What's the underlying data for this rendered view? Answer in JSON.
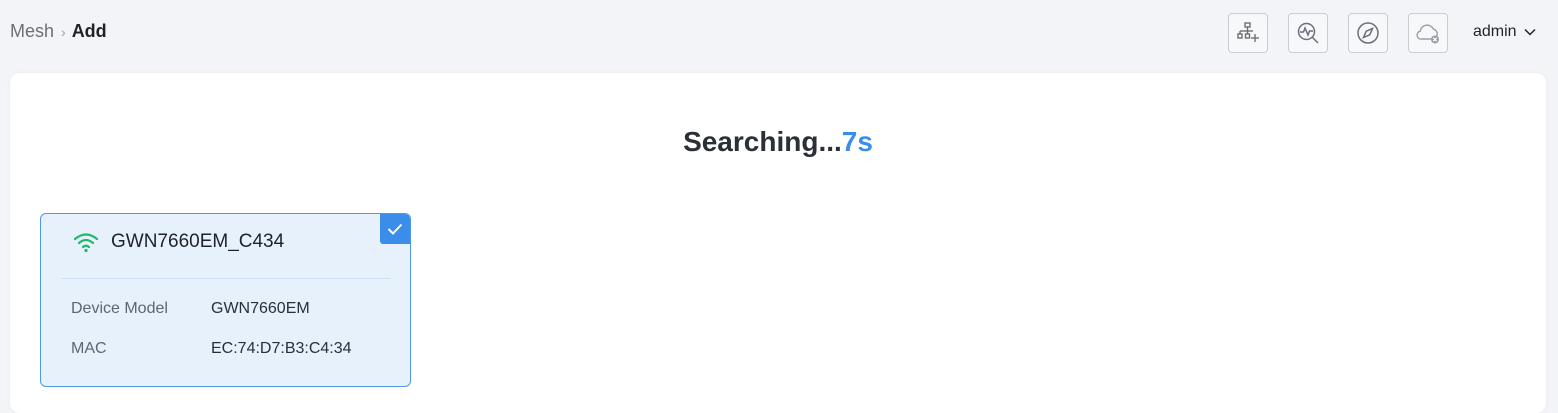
{
  "breadcrumb": {
    "parent": "Mesh",
    "separator": "›",
    "current": "Add"
  },
  "toolbar": {
    "buttons": [
      {
        "icon": "network-add-icon"
      },
      {
        "icon": "search-diagnostics-icon"
      },
      {
        "icon": "compass-icon"
      },
      {
        "icon": "cloud-disconnected-icon"
      }
    ]
  },
  "user": {
    "name": "admin"
  },
  "search": {
    "label": "Searching...",
    "seconds": "7s"
  },
  "device": {
    "name": "GWN7660EM_C434",
    "selected": true,
    "model_label": "Device Model",
    "model_value": "GWN7660EM",
    "mac_label": "MAC",
    "mac_value": "EC:74:D7:B3:C4:34"
  },
  "colors": {
    "accent": "#3a8de8",
    "wifi": "#1db86a",
    "card_bg": "#e6f1fc",
    "card_border": "#4f98e6"
  }
}
